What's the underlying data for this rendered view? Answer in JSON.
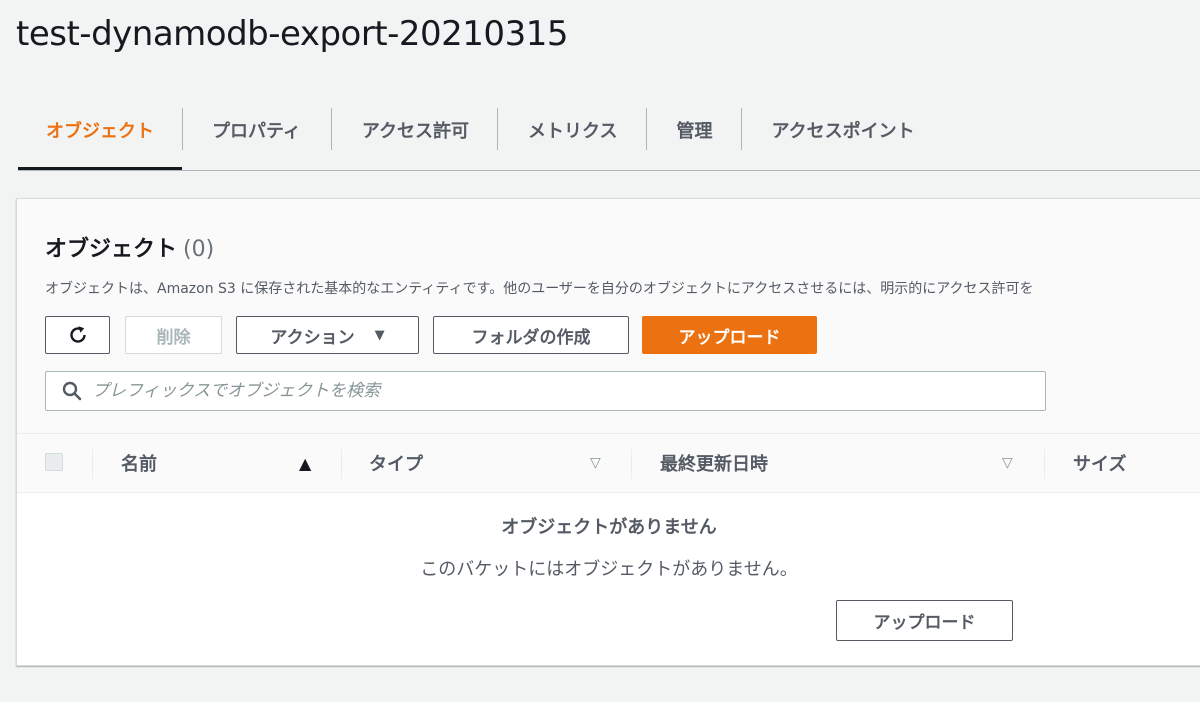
{
  "bucket": {
    "name": "test-dynamodb-export-20210315"
  },
  "tabs": [
    {
      "label": "オブジェクト",
      "active": true
    },
    {
      "label": "プロパティ",
      "active": false
    },
    {
      "label": "アクセス許可",
      "active": false
    },
    {
      "label": "メトリクス",
      "active": false
    },
    {
      "label": "管理",
      "active": false
    },
    {
      "label": "アクセスポイント",
      "active": false
    }
  ],
  "objects_panel": {
    "title": "オブジェクト",
    "count": "(0)",
    "description": "オブジェクトは、Amazon S3 に保存された基本的なエンティティです。他のユーザーを自分のオブジェクトにアクセスさせるには、明示的にアクセス許可を"
  },
  "toolbar": {
    "refresh_icon": "refresh-icon",
    "delete_label": "削除",
    "actions_label": "アクション",
    "actions_caret": "▼",
    "create_folder_label": "フォルダの作成",
    "upload_label": "アップロード"
  },
  "search": {
    "placeholder": "プレフィックスでオブジェクトを検索",
    "value": "",
    "icon": "search-icon"
  },
  "table": {
    "columns": [
      {
        "label": "名前",
        "sort_icon": "▲",
        "sorted": true
      },
      {
        "label": "タイプ",
        "sort_icon": "▽",
        "sorted": false
      },
      {
        "label": "最終更新日時",
        "sort_icon": "▽",
        "sorted": false
      },
      {
        "label": "サイズ",
        "sort_icon": "",
        "sorted": false
      }
    ],
    "rows": []
  },
  "empty_state": {
    "title": "オブジェクトがありません",
    "description": "このバケットにはオブジェクトがありません。",
    "upload_label": "アップロード"
  },
  "colors": {
    "accent": "#ec7211",
    "text": "#16191f",
    "muted": "#545b64",
    "background": "#f2f3f3"
  }
}
